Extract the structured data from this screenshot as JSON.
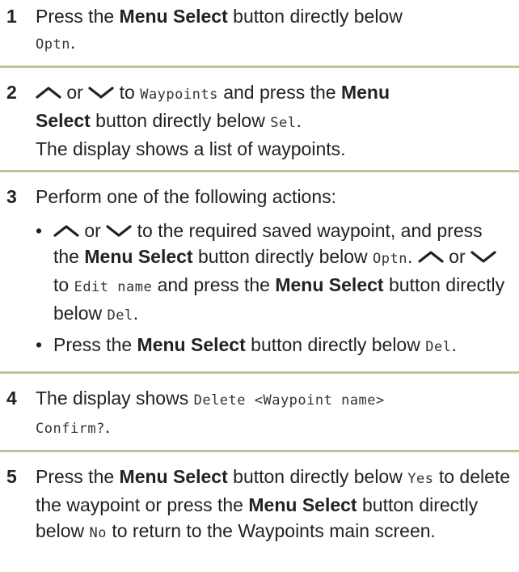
{
  "steps": [
    {
      "num": "1",
      "t1": "Press the ",
      "b1": "Menu Select",
      "t2": " button directly below",
      "c1": "Optn",
      "t3": "."
    },
    {
      "num": "2",
      "or": " or ",
      "t1": " to ",
      "c1": "Waypoints",
      "t2": " and press the ",
      "b1": "Menu",
      "b2": "Select",
      "t3": " button directly below ",
      "c2": "Sel",
      "t4": ".",
      "t5": "The display shows a list of waypoints."
    },
    {
      "num": "3",
      "t1": "Perform one of the following actions:",
      "bullet": "•",
      "s1": {
        "or": " or ",
        "t1": " to the required saved waypoint, and press the ",
        "b1": "Menu Select",
        "t2": " button directly below ",
        "c1": "Optn",
        "t3": ". ",
        "or2": " or ",
        "t4": " to ",
        "c2": "Edit name",
        "t5": " and press the ",
        "b2": "Menu Select",
        "t6": " button directly below ",
        "c3": "Del",
        "t7": "."
      },
      "s2": {
        "t1": "Press the ",
        "b1": "Menu Select",
        "t2": " button directly below ",
        "c1": "Del",
        "t3": "."
      }
    },
    {
      "num": "4",
      "t1": "The display shows ",
      "c1": "Delete <Waypoint name>",
      "c2": "Confirm?",
      "t2": "."
    },
    {
      "num": "5",
      "t1": "Press the ",
      "b1": "Menu Select",
      "t2": " button directly below ",
      "c1": "Yes",
      "t3": " to delete the waypoint or press the ",
      "b2": "Menu Select",
      "t4": " button directly below ",
      "c2": "No",
      "t5": " to return to the Waypoints main screen."
    }
  ],
  "icons": {
    "up": "up-arrow-icon",
    "down": "down-arrow-icon"
  },
  "colors": {
    "divider": "#b9c69a",
    "text": "#222222"
  }
}
